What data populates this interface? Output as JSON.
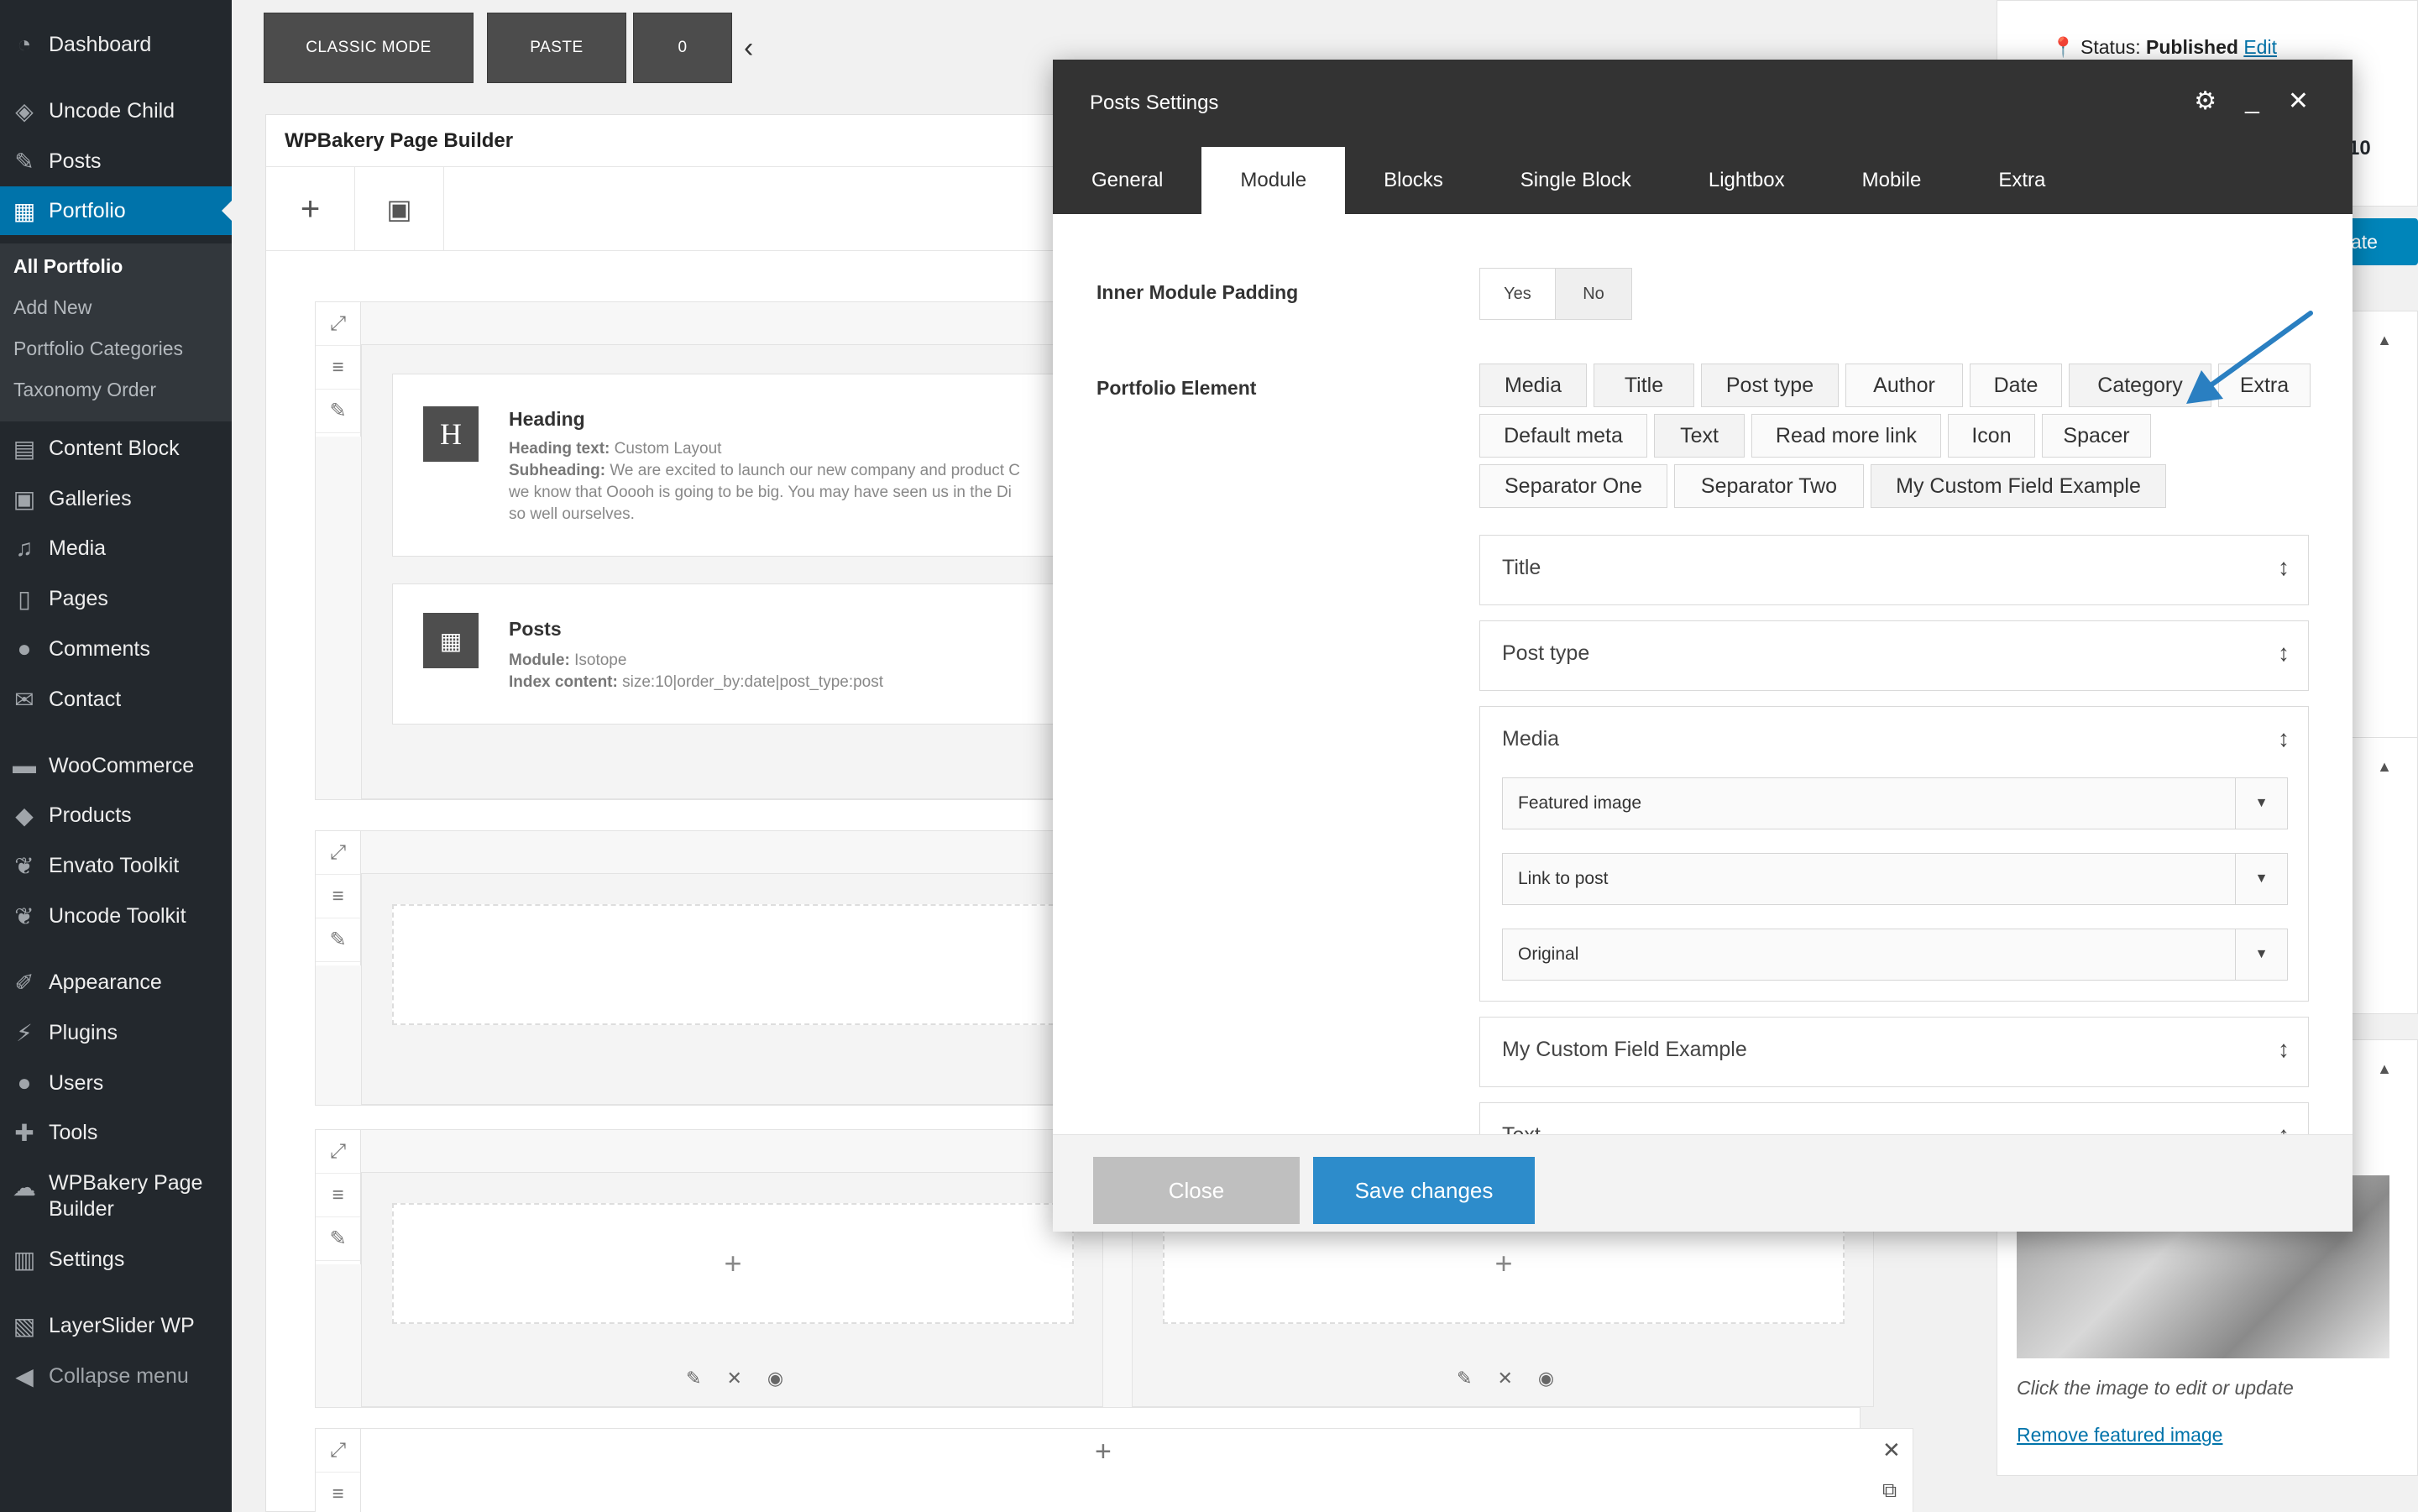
{
  "sidebar": {
    "items": [
      {
        "label": "Dashboard",
        "icon": "dashboard-icon"
      },
      {
        "label": "Uncode Child",
        "icon": "layers-icon"
      },
      {
        "label": "Posts",
        "icon": "pin-icon"
      },
      {
        "label": "Portfolio",
        "icon": "grid-icon"
      },
      {
        "label": "Content Block",
        "icon": "grid-icon"
      },
      {
        "label": "Galleries",
        "icon": "gallery-icon"
      },
      {
        "label": "Media",
        "icon": "media-icon"
      },
      {
        "label": "Pages",
        "icon": "pages-icon"
      },
      {
        "label": "Comments",
        "icon": "comments-icon"
      },
      {
        "label": "Contact",
        "icon": "mail-icon"
      },
      {
        "label": "WooCommerce",
        "icon": "woo-icon"
      },
      {
        "label": "Products",
        "icon": "box-icon"
      },
      {
        "label": "Envato Toolkit",
        "icon": "leaf-icon"
      },
      {
        "label": "Uncode Toolkit",
        "icon": "leaf-icon"
      },
      {
        "label": "Appearance",
        "icon": "brush-icon"
      },
      {
        "label": "Plugins",
        "icon": "plug-icon"
      },
      {
        "label": "Users",
        "icon": "user-icon"
      },
      {
        "label": "Tools",
        "icon": "wrench-icon"
      },
      {
        "label": "WPBakery Page Builder",
        "icon": "cloud-icon"
      },
      {
        "label": "Settings",
        "icon": "settings-icon"
      },
      {
        "label": "LayerSlider WP",
        "icon": "slides-icon"
      },
      {
        "label": "Collapse menu",
        "icon": "collapse-icon"
      }
    ],
    "submenu": [
      "All Portfolio",
      "Add New",
      "Portfolio Categories",
      "Taxonomy Order"
    ]
  },
  "toolbar": {
    "classic_mode": "CLASSIC MODE",
    "paste": "PASTE",
    "count": "0"
  },
  "builder": {
    "title": "WPBakery Page Builder",
    "heading_el": {
      "title": "Heading",
      "line1_label": "Heading text:",
      "line1_value": "Custom Layout",
      "line2_label": "Subheading:",
      "line2_value": "We are excited to launch our new company and product C",
      "line3": "we know that Ooooh is going to be big. You may have seen us in the Di",
      "line4": "so well ourselves."
    },
    "posts_el": {
      "title": "Posts",
      "line1_label": "Module:",
      "line1_value": "Isotope",
      "line2_label": "Index content:",
      "line2_value": "size:10|order_by:date|post_type:post"
    }
  },
  "sidepanel": {
    "status_label": "Status:",
    "status_value": "Published",
    "edit_link": "Edit",
    "time_fragment": ":10",
    "update_fragment": "ate",
    "caption": "Click the image to edit or update",
    "remove_link": "Remove featured image"
  },
  "modal": {
    "title": "Posts Settings",
    "tabs": [
      "General",
      "Module",
      "Blocks",
      "Single Block",
      "Lightbox",
      "Mobile",
      "Extra"
    ],
    "active_tab": "Module",
    "inner_padding_label": "Inner Module Padding",
    "yes": "Yes",
    "no": "No",
    "portfolio_element_label": "Portfolio Element",
    "chips": [
      "Media",
      "Title",
      "Post type",
      "Author",
      "Date",
      "Category",
      "Extra",
      "Default meta",
      "Text",
      "Read more link",
      "Icon",
      "Spacer",
      "Separator One",
      "Separator Two",
      "My Custom Field Example"
    ],
    "sortables": {
      "title": "Title",
      "post_type": "Post type",
      "media": "Media",
      "custom": "My Custom Field Example",
      "text": "Text"
    },
    "media_selects": [
      "Featured image",
      "Link to post",
      "Original"
    ],
    "close": "Close",
    "save": "Save changes",
    "accent_color": "#2d8ccb"
  }
}
